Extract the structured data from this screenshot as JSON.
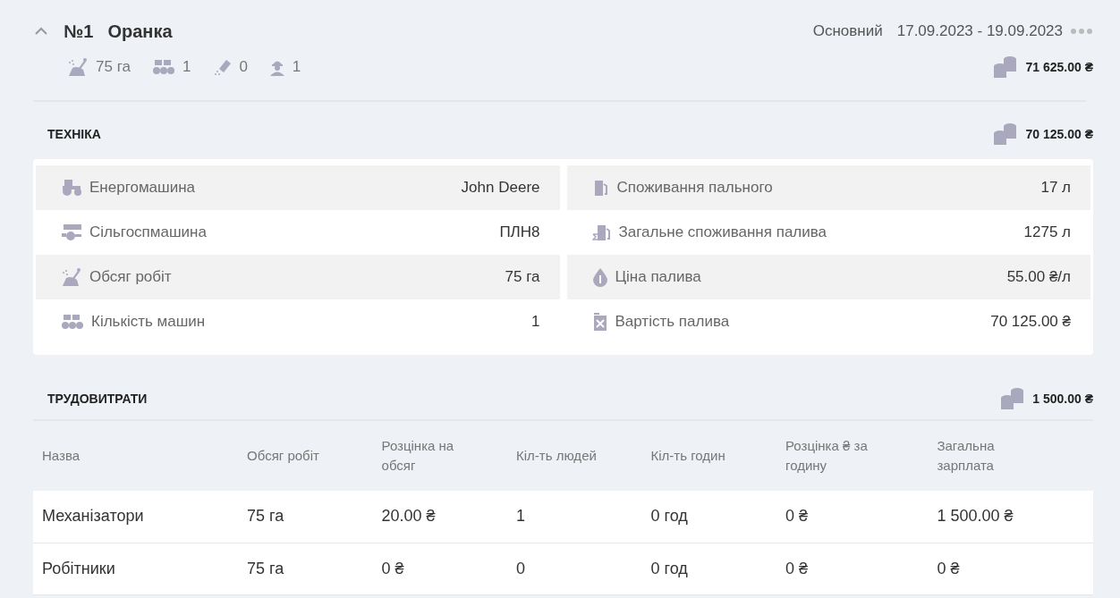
{
  "header": {
    "expanded": true,
    "number": "№1",
    "name": "Оранка",
    "type": "Основний",
    "dates": "17.09.2023 - 19.09.2023",
    "total": "71 625.00 ₴"
  },
  "stats": [
    {
      "value": "75 га"
    },
    {
      "value": "1"
    },
    {
      "value": "0"
    },
    {
      "value": "1"
    }
  ],
  "machinery": {
    "title": "ТЕХНІКА",
    "total": "70 125.00 ₴",
    "left": [
      {
        "label": "Енергомашина",
        "value": "John Deere"
      },
      {
        "label": "Сільгоспмашина",
        "value": "ПЛН8"
      },
      {
        "label": "Обсяг робіт",
        "value": "75 га"
      },
      {
        "label": "Кількість машин",
        "value": "1"
      }
    ],
    "right": [
      {
        "label": "Споживання пального",
        "value": "17 л"
      },
      {
        "label": "Загальне споживання палива",
        "value": "1275 л"
      },
      {
        "label": "Ціна палива",
        "value": "55.00 ₴/л"
      },
      {
        "label": "Вартість палива",
        "value": "70 125.00 ₴"
      }
    ]
  },
  "labor": {
    "title": "ТРУДОВИТРАТИ",
    "total": "1 500.00 ₴",
    "columns": [
      "Назва",
      "Обсяг робіт",
      "Розцінка на обсяг",
      "Кіл-ть людей",
      "Кіл-ть годин",
      "Розцінка ₴ за годину",
      "Загальна зарплата"
    ],
    "rows": [
      [
        "Механізатори",
        "75 га",
        "20.00 ₴",
        "1",
        "0 год",
        "0 ₴",
        "1 500.00 ₴"
      ],
      [
        "Робітники",
        "75 га",
        "0 ₴",
        "0",
        "0 год",
        "0 ₴",
        "0 ₴"
      ]
    ]
  }
}
